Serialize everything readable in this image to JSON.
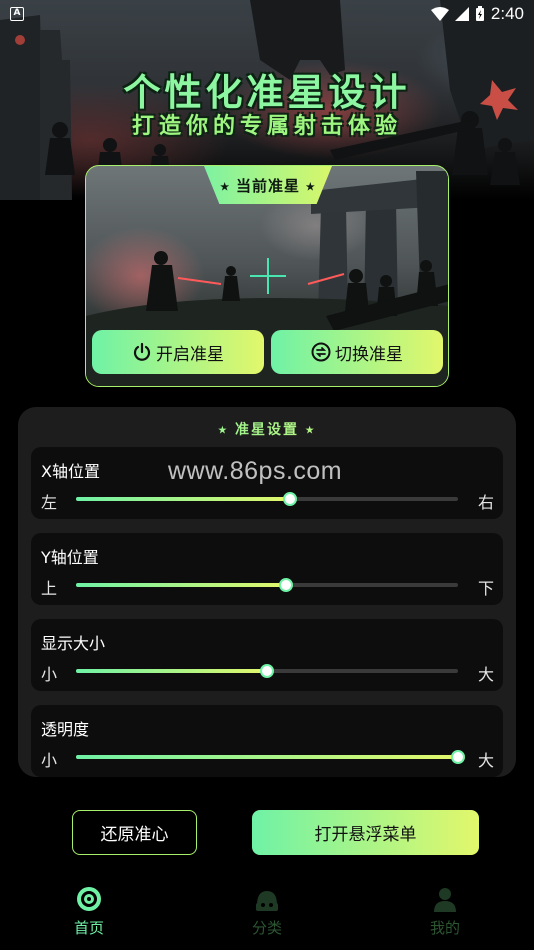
{
  "status_bar": {
    "time": "2:40",
    "app_badge": "A"
  },
  "hero": {
    "title": "个性化准星设计",
    "subtitle": "打造你的专属射击体验"
  },
  "preview_card": {
    "tab_label": "⭑ 当前准星 ⭑",
    "crosshair_color": "#49e6b0",
    "enable_button": "开启准星",
    "switch_button": "切换准星"
  },
  "settings": {
    "title": "⭑ 准星设置 ⭑",
    "sliders": [
      {
        "label": "X轴位置",
        "min_label": "左",
        "max_label": "右",
        "value": 0.56
      },
      {
        "label": "Y轴位置",
        "min_label": "上",
        "max_label": "下",
        "value": 0.55
      },
      {
        "label": "显示大小",
        "min_label": "小",
        "max_label": "大",
        "value": 0.5
      },
      {
        "label": "透明度",
        "min_label": "小",
        "max_label": "大",
        "value": 1.0
      }
    ]
  },
  "watermark": "www.86ps.com",
  "actions": {
    "reset": "还原准心",
    "float_menu": "打开悬浮菜单"
  },
  "nav": [
    {
      "label": "首页",
      "icon": "target-icon",
      "active": true
    },
    {
      "label": "分类",
      "icon": "category-icon",
      "active": false
    },
    {
      "label": "我的",
      "icon": "profile-icon",
      "active": false
    }
  ],
  "colors": {
    "accent_start": "#6ff2a6",
    "accent_end": "#e2f76b",
    "panel_bg": "#1d1d1d"
  }
}
